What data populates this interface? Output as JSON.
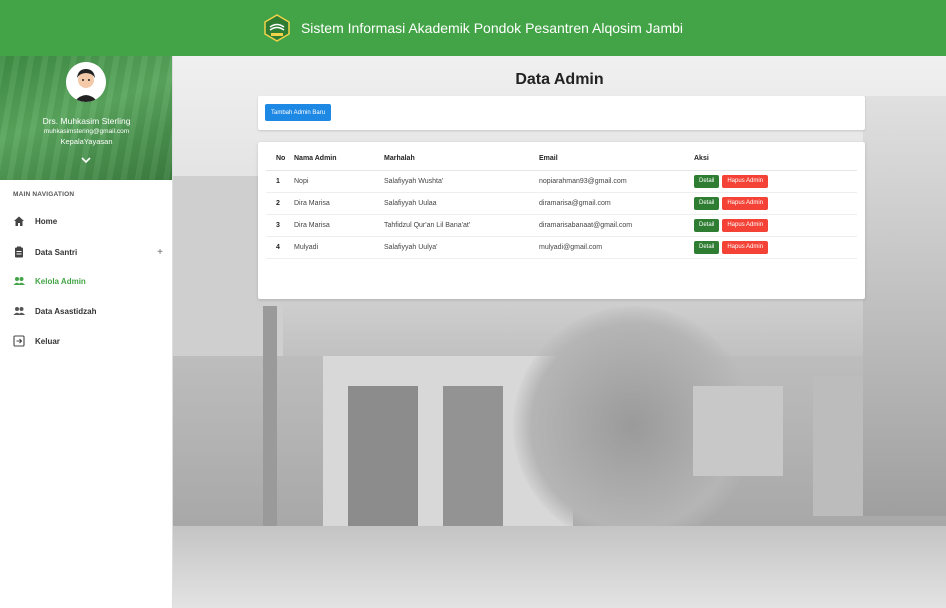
{
  "header": {
    "title": "Sistem Informasi Akademik Pondok Pesantren Alqosim Jambi",
    "logo_icon": "school-logo-icon"
  },
  "sidebar": {
    "profile": {
      "name": "Drs. Muhkasim Sterling",
      "email": "muhkasimstering@gmail.com",
      "role": "KepalaYayasan"
    },
    "nav_header": "MAIN NAVIGATION",
    "items": [
      {
        "label": "Home",
        "icon": "home-icon"
      },
      {
        "label": "Data Santri",
        "icon": "clipboard-icon",
        "expand": "+"
      },
      {
        "label": "Kelola Admin",
        "icon": "people-icon",
        "active": true
      },
      {
        "label": "Data Asastidzah",
        "icon": "people-icon"
      },
      {
        "label": "Keluar",
        "icon": "logout-icon"
      }
    ]
  },
  "main": {
    "page_title": "Data Admin",
    "add_button": "Tambah Admin Baru",
    "table": {
      "headers": [
        "No",
        "Nama Admin",
        "Marhalah",
        "Email",
        "Aksi"
      ],
      "rows": [
        {
          "no": "1",
          "nama": "Nopi",
          "marhalah": "Salafiyyah Wushta'",
          "email": "nopiarahman93@gmail.com"
        },
        {
          "no": "2",
          "nama": "Dira Marisa",
          "marhalah": "Salafiyyah Uulaa",
          "email": "diramarisa@gmail.com"
        },
        {
          "no": "3",
          "nama": "Dira Marisa",
          "marhalah": "Tahfidzul Qur'an Lil Bana'at'",
          "email": "diramarisabanaat@gmail.com"
        },
        {
          "no": "4",
          "nama": "Mulyadi",
          "marhalah": "Salafiyyah Uulya'",
          "email": "mulyadi@gmail.com"
        }
      ],
      "detail_label": "Detail",
      "delete_label": "Hapus Admin"
    }
  },
  "colors": {
    "brand_green": "#43a447",
    "add_blue": "#1e88e5",
    "detail_green": "#2e7d32",
    "delete_red": "#f44336"
  }
}
